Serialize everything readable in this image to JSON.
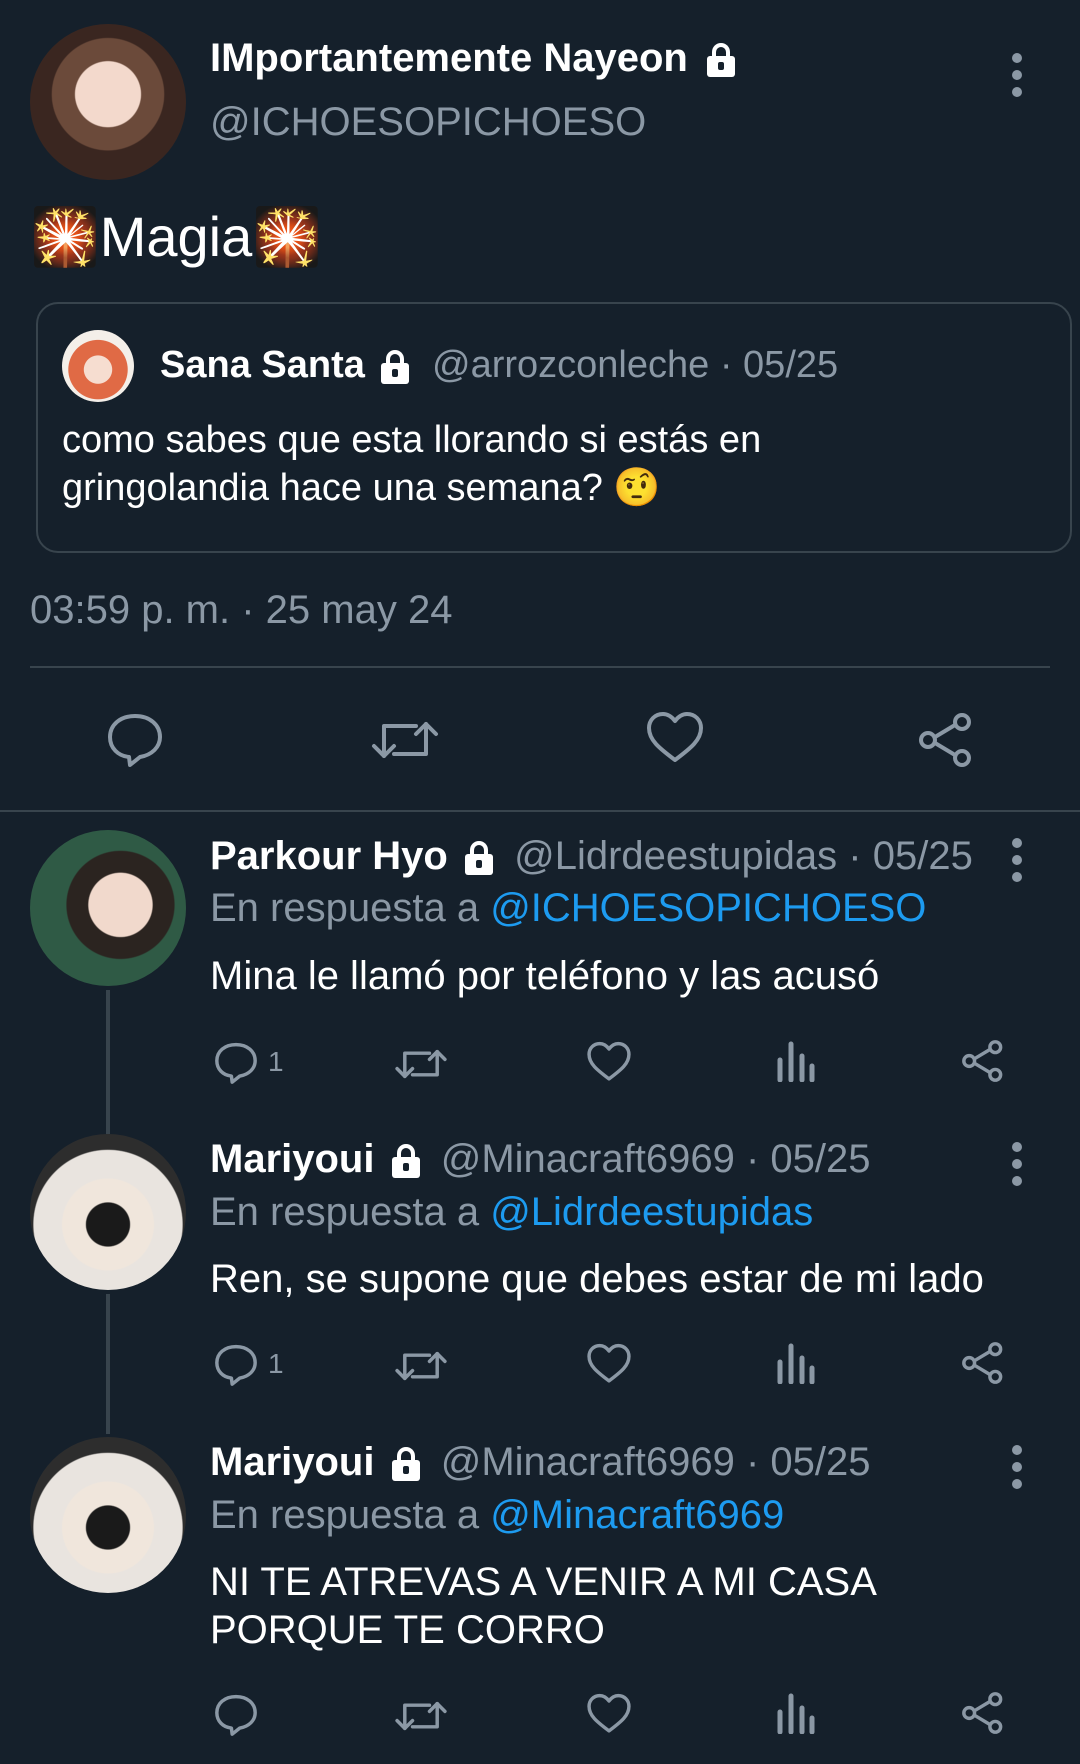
{
  "main_tweet": {
    "author_name": "IMportantemente Nayeon",
    "author_handle": "@ICHOESOPICHOESO",
    "text_prefix_emoji": "🎇",
    "text": "Magia",
    "text_suffix_emoji": "🎇",
    "timestamp": "03:59 p. m. · 25 may 24",
    "quote": {
      "author_name": "Sana Santa",
      "author_handle": "@arrozconleche",
      "date": "05/25",
      "text_line1": "como sabes que esta llorando si estás en",
      "text_line2": "gringolandia hace una semana?",
      "emoji": "🤨"
    }
  },
  "reply_prefix": "En respuesta a",
  "date_separator": "·",
  "replies": [
    {
      "author_name": "Parkour Hyo",
      "author_handle": "@Lidrdeestupidas",
      "date": "05/25",
      "reply_to": "@ICHOESOPICHOESO",
      "text": "Mina le llamó por teléfono y las acusó",
      "reply_count": "1"
    },
    {
      "author_name": "Mariyoui",
      "author_handle": "@Minacraft6969",
      "date": "05/25",
      "reply_to": "@Lidrdeestupidas",
      "text": "Ren, se supone que debes estar de mi lado",
      "reply_count": "1"
    },
    {
      "author_name": "Mariyoui",
      "author_handle": "@Minacraft6969",
      "date": "05/25",
      "reply_to": "@Minacraft6969",
      "text_line1": "NI TE ATREVAS A VENIR A MI CASA",
      "text_line2": "PORQUE TE CORRO",
      "reply_count": ""
    }
  ],
  "colors": {
    "background": "#15202b",
    "muted": "#8b98a5",
    "link": "#1d9bf0",
    "border": "#38444d"
  }
}
